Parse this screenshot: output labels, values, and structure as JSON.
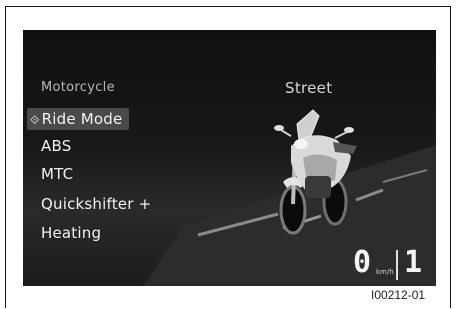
{
  "display": {
    "menu_title": "Motorcycle",
    "selected_mode": "Street",
    "menu_items": [
      {
        "label": "Ride Mode",
        "selected": true
      },
      {
        "label": "ABS",
        "selected": false
      },
      {
        "label": "MTC",
        "selected": false
      },
      {
        "label": "Quickshifter +",
        "selected": false
      },
      {
        "label": "Heating",
        "selected": false
      }
    ],
    "selected_marker": "⟐",
    "speed": "0",
    "speed_unit": "km/h",
    "gear": "1"
  },
  "caption": "I00212-01",
  "colors": {
    "screen_bg": "#141414",
    "text": "#f2f2f2",
    "highlight": "#4a4a4a"
  }
}
